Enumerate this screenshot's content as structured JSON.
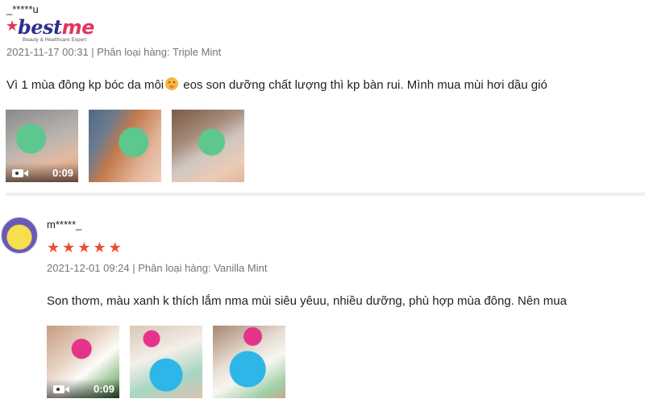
{
  "reviews": [
    {
      "username": "_*****u",
      "logo": {
        "word_main": "best",
        "word_accent": "me",
        "tagline": "Beauty & Healthcare Expert"
      },
      "meta": "2021-11-17 00:31 | Phân loại hàng: Triple Mint",
      "text_before_emoji": "Vì 1 mùa đông kp bóc da môi",
      "text_after_emoji": " eos son dưỡng chất lượng thì kp bàn rui. Mình mua mùi hơi dầu gió",
      "video_duration": "0:09"
    },
    {
      "username": "m*****_",
      "rating": 5,
      "meta": "2021-12-01 09:24 | Phân loại hàng: Vanilla Mint",
      "text": "Son thơm, màu xanh k thích lắm nma mùi siêu yêuu, nhiều dưỡng, phù hợp mùa đông. Nên mua",
      "video_duration": "0:09"
    }
  ],
  "icons": {
    "video": "video-camera-icon",
    "star": "star-icon",
    "emoji": "emoji-icon"
  },
  "colors": {
    "star": "#ee4d2d",
    "meta": "#757575",
    "brand_blue": "#2d2f8f",
    "brand_pink": "#e4345b"
  }
}
